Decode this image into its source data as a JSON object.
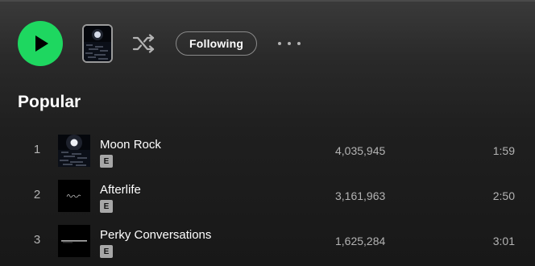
{
  "colors": {
    "accent": "#1ed760",
    "text_primary": "#ffffff",
    "text_secondary": "#b3b3b3",
    "background": "#181818"
  },
  "action_bar": {
    "play_icon": "play-icon",
    "artist_image": "moon-over-water-image",
    "shuffle_icon": "shuffle-icon",
    "follow_label": "Following",
    "more_icon": "more-options-icon"
  },
  "popular": {
    "title": "Popular",
    "tracks": [
      {
        "number": "1",
        "title": "Moon Rock",
        "explicit": "E",
        "plays": "4,035,945",
        "duration": "1:59",
        "cover": "moon-over-water"
      },
      {
        "number": "2",
        "title": "Afterlife",
        "explicit": "E",
        "plays": "3,161,963",
        "duration": "2:50",
        "cover": "afterlife-script"
      },
      {
        "number": "3",
        "title": "Perky Conversations",
        "explicit": "E",
        "plays": "1,625,284",
        "duration": "3:01",
        "cover": "perky-text"
      }
    ]
  }
}
